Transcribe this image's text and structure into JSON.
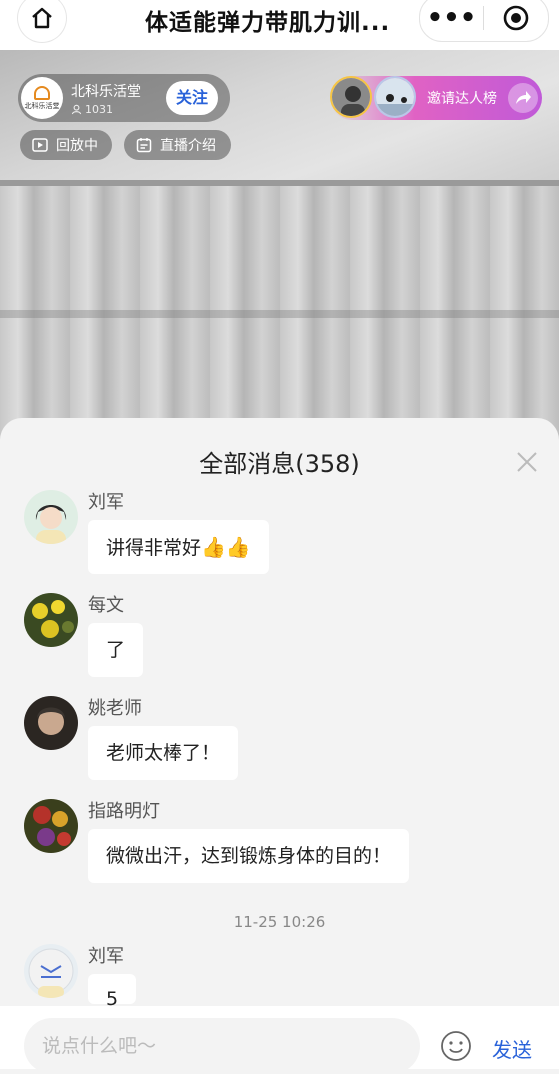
{
  "topbar": {
    "title": "体适能弹力带肌力训...",
    "more_label": "•••"
  },
  "streamer": {
    "name": "北科乐活堂",
    "logo_text": "北科乐活堂",
    "follower_count": "1031",
    "follow_label": "关注"
  },
  "live_tags": {
    "replay_label": "回放中",
    "intro_label": "直播介绍"
  },
  "invite": {
    "label": "邀请达人榜"
  },
  "panel": {
    "title": "全部消息(358)"
  },
  "messages": [
    {
      "user": "刘军",
      "text": "讲得非常好",
      "emoji": "👍👍"
    },
    {
      "user": "每文",
      "text": "了"
    },
    {
      "user": "姚老师",
      "text": "老师太棒了！"
    },
    {
      "user": "指路明灯",
      "text": "微微出汗，达到锻炼身体的目的！"
    },
    {
      "user": "刘军",
      "text": "5"
    }
  ],
  "timestamp": "11-25 10:26",
  "input": {
    "placeholder": "说点什么吧～",
    "send_label": "发送"
  },
  "colors": {
    "accent_blue": "#2962d9",
    "invite_pink": "#e062c4",
    "panel_bg": "#f3f3f3"
  }
}
